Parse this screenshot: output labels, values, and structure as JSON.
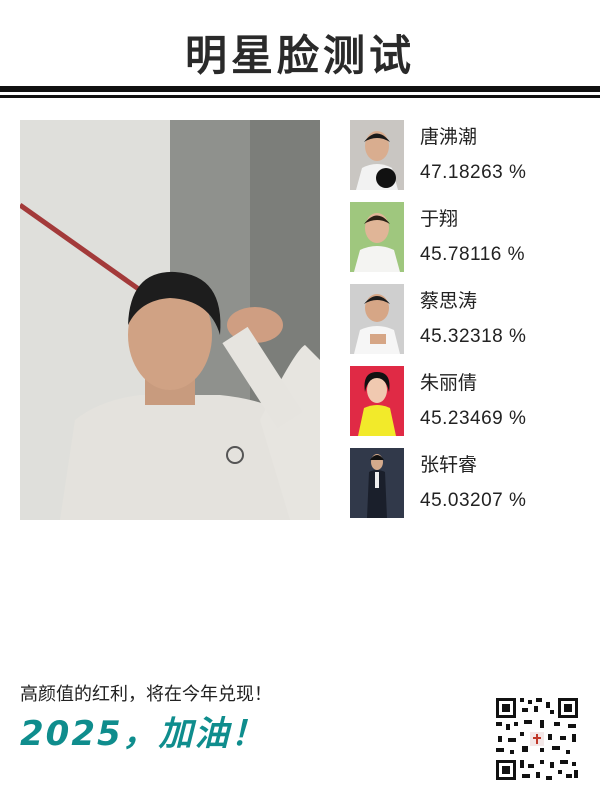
{
  "header": {
    "title": "明星脸测试"
  },
  "matches": [
    {
      "name": "唐沸潮",
      "score": "47.18263 %"
    },
    {
      "name": "于翔",
      "score": "45.78116 %"
    },
    {
      "name": "蔡思涛",
      "score": "45.32318 %"
    },
    {
      "name": "朱丽倩",
      "score": "45.23469 %"
    },
    {
      "name": "张轩睿",
      "score": "45.03207 %"
    }
  ],
  "footer": {
    "tagline": "高颜值的红利，将在今年兑现！",
    "slogan": "2025，加油！"
  },
  "colors": {
    "accent": "#0f8d8d",
    "rule": "#111111",
    "title": "#2a2a2a"
  }
}
